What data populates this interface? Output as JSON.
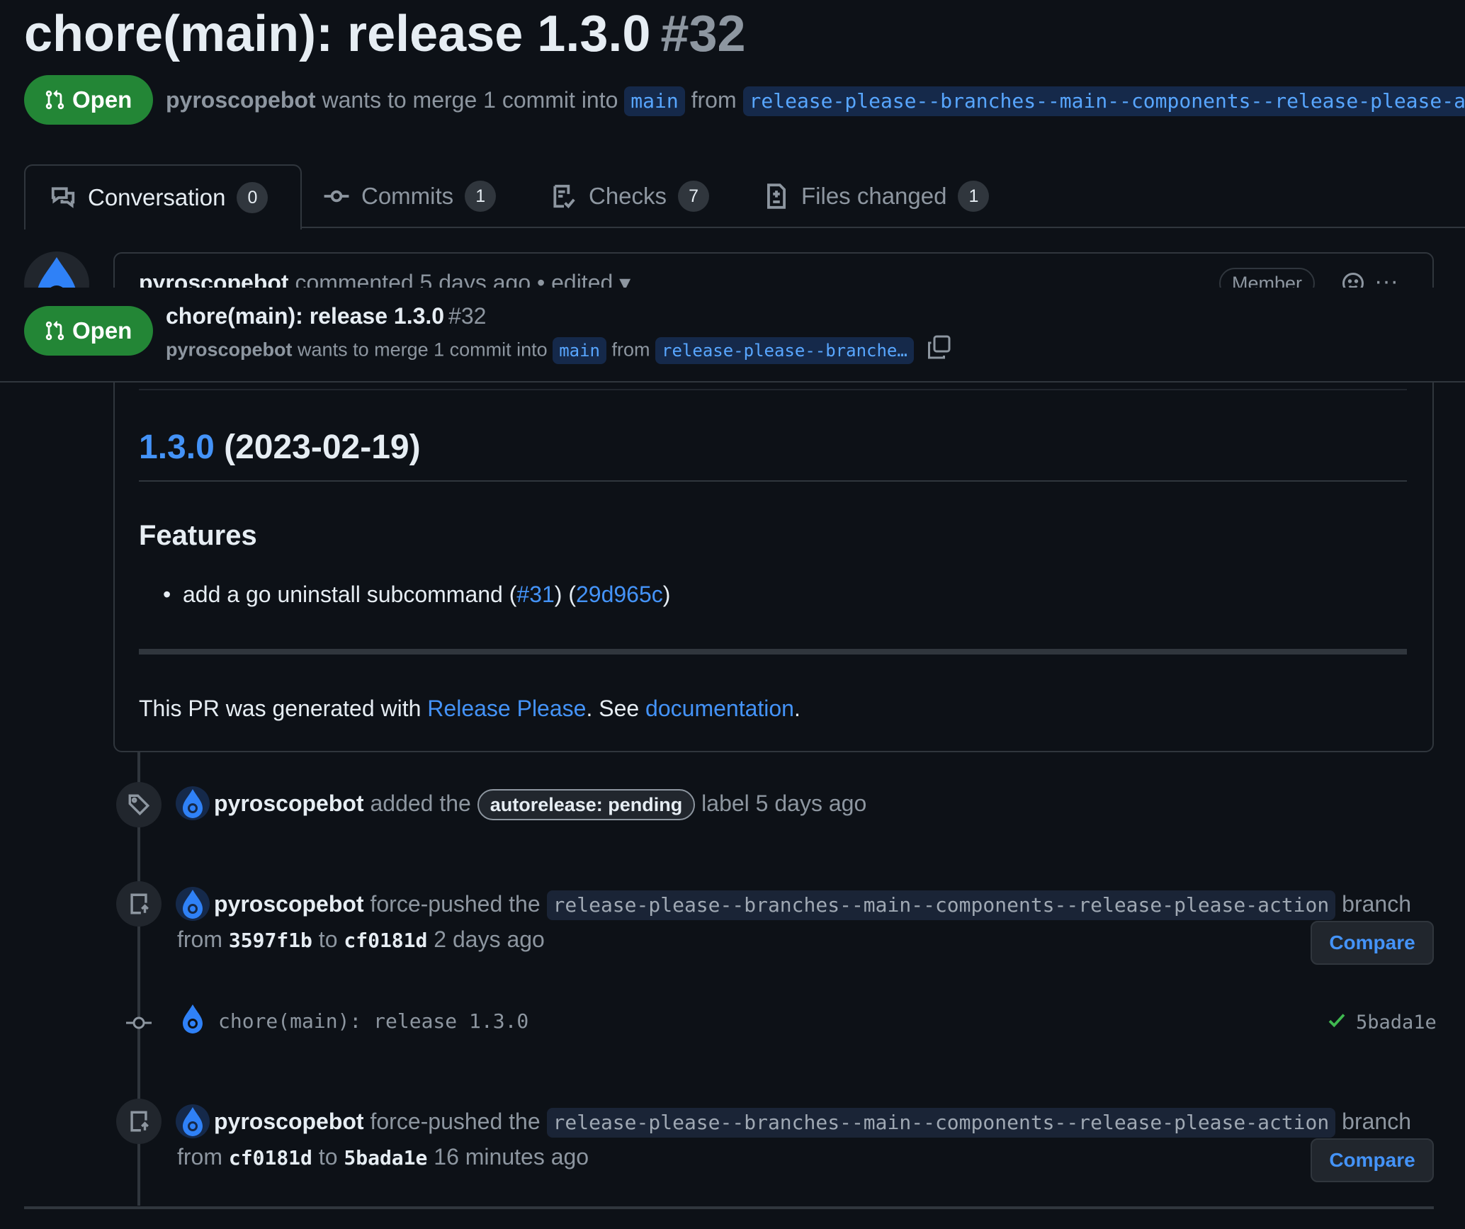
{
  "pr": {
    "title": "chore(main): release 1.3.0",
    "number": "#32",
    "state": "Open",
    "author": "pyroscopebot",
    "merge_text": "wants to merge 1 commit into",
    "base_branch": "main",
    "from_text": "from",
    "head_branch": "release-please--branches--main--components--release-please-action",
    "head_branch_truncated": "release-please--branche…"
  },
  "tabs": [
    {
      "label": "Conversation",
      "count": "0",
      "icon": "comment-discussion-icon"
    },
    {
      "label": "Commits",
      "count": "1",
      "icon": "git-commit-icon"
    },
    {
      "label": "Checks",
      "count": "7",
      "icon": "checklist-icon"
    },
    {
      "label": "Files changed",
      "count": "1",
      "icon": "file-diff-icon"
    }
  ],
  "comment": {
    "author": "pyroscopebot",
    "action": "commented 5 days ago",
    "separator": "•",
    "edited": "edited",
    "badge": "Member",
    "release_version": "1.3.0",
    "release_date": "(2023-02-19)",
    "features_heading": "Features",
    "feature_text": "add a go uninstall subcommand (",
    "feature_pr": "#31",
    "feature_mid": ") (",
    "feature_commit": "29d965c",
    "feature_end": ")",
    "generated_prefix": "This PR was generated with ",
    "generated_link1": "Release Please",
    "generated_mid": ". See ",
    "generated_link2": "documentation",
    "generated_end": "."
  },
  "timeline": {
    "label_event": {
      "actor": "pyroscopebot",
      "action": "added the",
      "label": "autorelease: pending",
      "suffix": "label 5 days ago"
    },
    "push_event_1": {
      "actor": "pyroscopebot",
      "action": "force-pushed the",
      "branch": "release-please--branches--main--components--release-please-action",
      "branch_word": "branch",
      "from": "from",
      "sha_from": "3597f1b",
      "to": "to",
      "sha_to": "cf0181d",
      "when": "2 days ago",
      "button": "Compare"
    },
    "commit": {
      "message": "chore(main): release 1.3.0",
      "sha": "5bada1e"
    },
    "push_event_2": {
      "actor": "pyroscopebot",
      "action": "force-pushed the",
      "branch": "release-please--branches--main--components--release-please-action",
      "branch_word": "branch",
      "from": "from",
      "sha_from": "cf0181d",
      "to": "to",
      "sha_to": "5bada1e",
      "when": "16 minutes ago",
      "button": "Compare"
    }
  },
  "colors": {
    "background": "#0d1117",
    "open_green": "#238636",
    "link_blue": "#4493f8",
    "muted": "#8d96a0",
    "border": "#30363d",
    "success": "#3fb950"
  }
}
